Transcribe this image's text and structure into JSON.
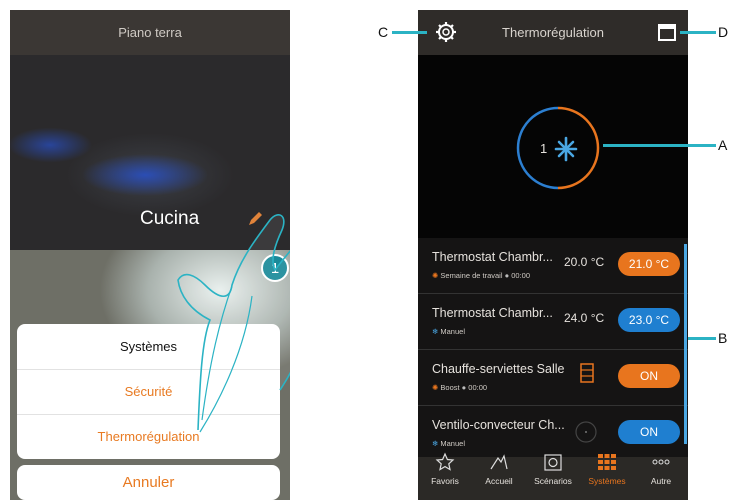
{
  "left_screen": {
    "header_title": "Piano terra",
    "room_name": "Cucina",
    "step_number": "1",
    "menu": {
      "items": [
        {
          "label": "Systèmes",
          "color": "#111111"
        },
        {
          "label": "Sécurité",
          "color": "#e87a22"
        },
        {
          "label": "Thermorégulation",
          "color": "#e87a22"
        }
      ],
      "cancel_label": "Annuler"
    }
  },
  "right_screen": {
    "header_title": "Thermorégulation",
    "dial": {
      "value": "1",
      "icon": "snowflake-icon",
      "colors": {
        "cool": "#2c7fd1",
        "heat": "#e8751e"
      }
    },
    "devices": [
      {
        "name": "Thermostat Chambr...",
        "mode_icon": "sun-icon",
        "mode": "Semaine de travail",
        "time": "00:00",
        "temp": "20.0 °C",
        "setpoint": "21.0 °C",
        "pill_color": "#e8751e"
      },
      {
        "name": "Thermostat Chambr...",
        "mode_icon": "snowflake-icon",
        "mode": "Manuel",
        "time": "",
        "temp": "24.0 °C",
        "setpoint": "23.0 °C",
        "pill_color": "#1f7fd0"
      },
      {
        "name": "Chauffe-serviettes Salle",
        "mode_icon": "sun-icon",
        "mode": "Boost",
        "time": "00:00",
        "temp": "",
        "setpoint": "ON",
        "pill_color": "#e8751e"
      },
      {
        "name": "Ventilo-convecteur Ch...",
        "mode_icon": "snowflake-icon",
        "mode": "Manuel",
        "time": "",
        "temp": "",
        "setpoint": "ON",
        "pill_color": "#1f7fd0"
      }
    ],
    "tabs": [
      {
        "label": "Favoris",
        "icon": "star-icon",
        "active": false
      },
      {
        "label": "Accueil",
        "icon": "home-icon",
        "active": false
      },
      {
        "label": "Scénarios",
        "icon": "scenarios-icon",
        "active": false
      },
      {
        "label": "Systèmes",
        "icon": "grid-icon",
        "active": true
      },
      {
        "label": "Autre",
        "icon": "more-icon",
        "active": false
      }
    ]
  },
  "callouts": {
    "a": "A",
    "b": "B",
    "c": "C",
    "d": "D"
  },
  "accent_color": "#e8751e"
}
